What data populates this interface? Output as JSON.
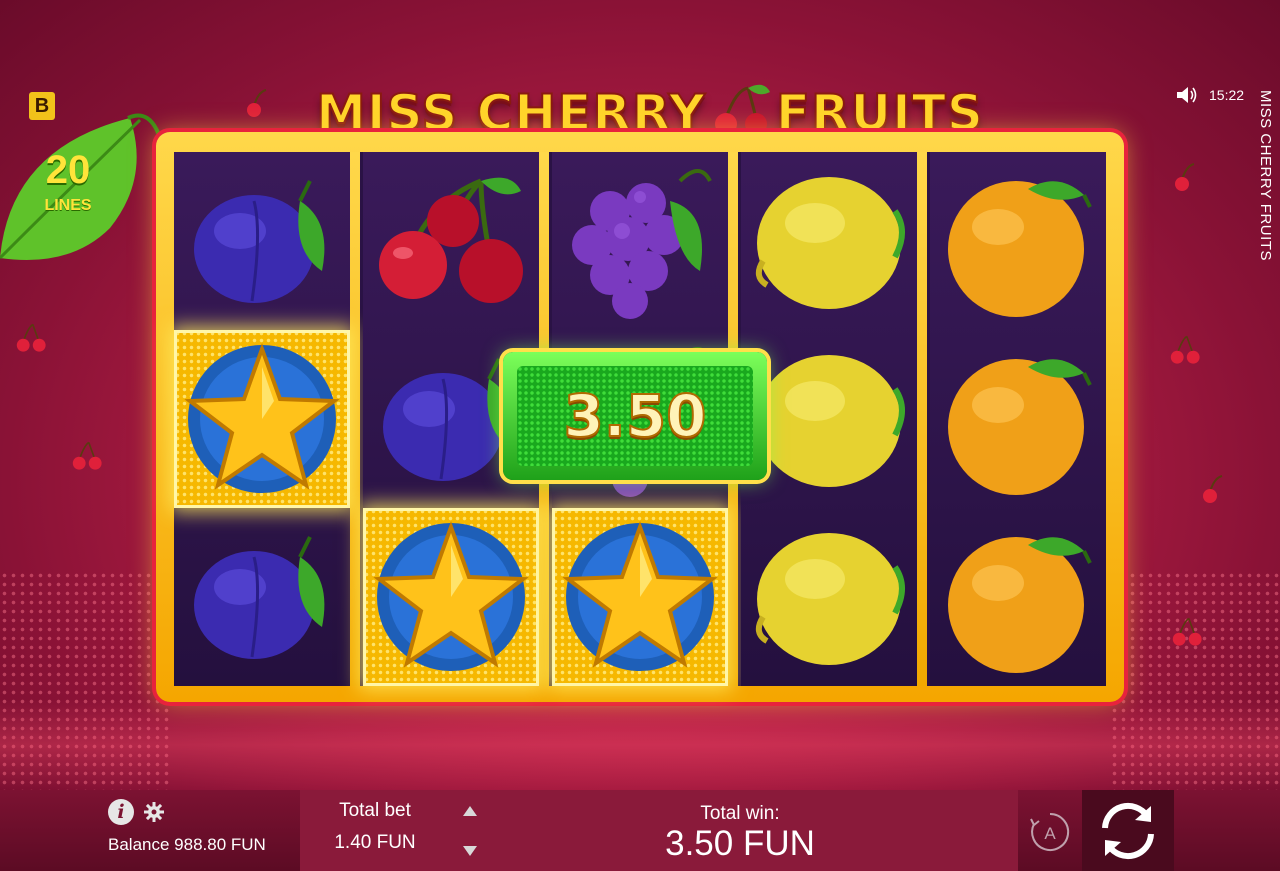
{
  "brand": {
    "letter": "B"
  },
  "lines": {
    "count": "20",
    "label": "LINES"
  },
  "title": {
    "part1": "MISS CHERRY",
    "part2": "FRUITS"
  },
  "side_title": "MISS CHERRY FRUITS",
  "clock": "15:22",
  "reels": [
    [
      "plum",
      "star",
      "plum"
    ],
    [
      "cherry",
      "plum",
      "star"
    ],
    [
      "grape",
      "grape",
      "star"
    ],
    [
      "lemon",
      "lemon",
      "lemon"
    ],
    [
      "orange",
      "orange",
      "orange"
    ]
  ],
  "winning_cells": [
    [
      0,
      1
    ],
    [
      1,
      2
    ],
    [
      2,
      2
    ]
  ],
  "win_popup": {
    "value": "3.50"
  },
  "bottom": {
    "balance": "Balance 988.80 FUN",
    "total_bet_label": "Total bet",
    "total_bet_value": "1.40 FUN",
    "total_win_label": "Total win:",
    "total_win_value": "3.50 FUN",
    "auto_label": "A"
  },
  "colors": {
    "accent": "#ffd52a",
    "background": "#b51f45",
    "win_green": "#1fa11a"
  }
}
